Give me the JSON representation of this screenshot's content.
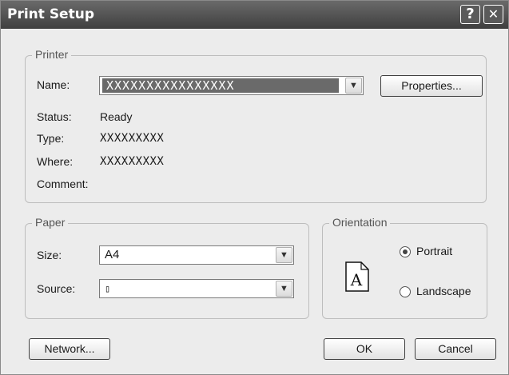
{
  "window": {
    "title": "Print Setup",
    "help_glyph": "?",
    "close_glyph": "✕"
  },
  "printer": {
    "legend": "Printer",
    "name_label": "Name:",
    "name_value": "XXXXXXXXXXXXXXXX",
    "properties_label": "Properties...",
    "status_label": "Status:",
    "status_value": "Ready",
    "type_label": "Type:",
    "type_value": "XXXXXXXXX",
    "where_label": "Where:",
    "where_value": "XXXXXXXXX",
    "comment_label": "Comment:",
    "comment_value": ""
  },
  "paper": {
    "legend": "Paper",
    "size_label": "Size:",
    "size_value": "A4",
    "source_label": "Source:",
    "source_value": "▯"
  },
  "orientation": {
    "legend": "Orientation",
    "page_glyph": "A",
    "portrait_label": "Portrait",
    "landscape_label": "Landscape",
    "selected": "Portrait"
  },
  "buttons": {
    "network": "Network...",
    "ok": "OK",
    "cancel": "Cancel"
  },
  "icons": {
    "dropdown": "chevron-down-icon",
    "page": "page-portrait-icon"
  }
}
